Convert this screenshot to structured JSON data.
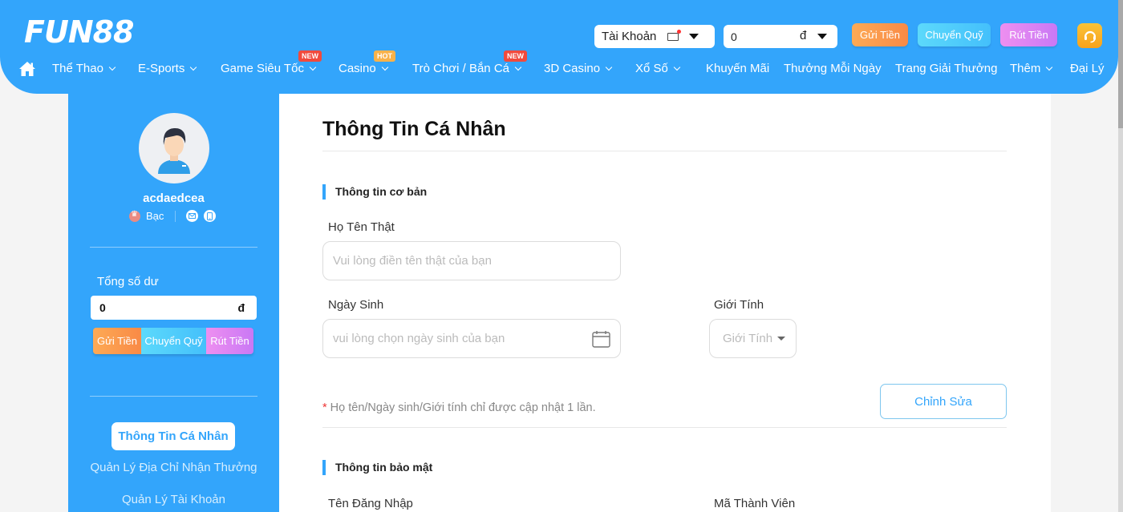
{
  "header": {
    "logo": "FUN88",
    "account": {
      "label": "Tài Khoản",
      "has_notification": true
    },
    "balance": {
      "value": "0",
      "currency": "đ"
    },
    "buttons": {
      "deposit": "Gửi Tiền",
      "transfer": "Chuyển Quỹ",
      "withdraw": "Rút Tiền"
    },
    "colors": {
      "primary": "#33a5fb",
      "deposit": "#f98a46",
      "transfer": "#44c0fb",
      "withdraw": "#c978f5",
      "support": "#f7a21b"
    }
  },
  "nav": {
    "items": [
      {
        "label": "Thể Thao",
        "dropdown": true
      },
      {
        "label": "E-Sports",
        "dropdown": true
      },
      {
        "label": "Game Siêu Tốc",
        "dropdown": true,
        "badge": "NEW"
      },
      {
        "label": "Casino",
        "dropdown": true,
        "badge": "HOT"
      },
      {
        "label": "Trò Chơi / Bắn Cá",
        "dropdown": true,
        "badge": "NEW"
      },
      {
        "label": "3D Casino",
        "dropdown": true
      },
      {
        "label": "Xổ Số",
        "dropdown": true
      },
      {
        "label": "Khuyến Mãi",
        "dropdown": false
      },
      {
        "label": "Thưởng Mỗi Ngày",
        "dropdown": false
      },
      {
        "label": "Trang Giải Thưởng",
        "dropdown": false
      },
      {
        "label": "Thêm",
        "dropdown": true
      },
      {
        "label": "Đại Lý",
        "dropdown": false
      }
    ]
  },
  "sidebar": {
    "username": "acdaedcea",
    "tier": "Bạc",
    "balance_label": "Tổng số dư",
    "balance_value": "0",
    "balance_currency": "đ",
    "buttons": {
      "deposit": "Gửi Tiền",
      "transfer": "Chuyển Quỹ",
      "withdraw": "Rút Tiền"
    },
    "menu": [
      {
        "label": "Thông Tin Cá Nhân",
        "active": true
      },
      {
        "label": "Quản Lý Địa Chỉ Nhận Thưởng",
        "active": false
      },
      {
        "label": "Quản Lý Tài Khoản",
        "active": false
      }
    ]
  },
  "main": {
    "title": "Thông Tin Cá Nhân",
    "basic_section": {
      "title": "Thông tin cơ bản",
      "full_name": {
        "label": "Họ Tên Thật",
        "placeholder": "Vui lòng điền tên thật của bạn",
        "value": ""
      },
      "birthday": {
        "label": "Ngày Sinh",
        "placeholder": "vui lòng chọn ngày sinh của bạn",
        "value": ""
      },
      "gender": {
        "label": "Giới Tính",
        "placeholder": "Giới Tính"
      },
      "note_star": "*",
      "note": "Họ tên/Ngày sinh/Giới tính chỉ được cập nhật 1 lần.",
      "edit_button": "Chỉnh Sửa"
    },
    "security_section": {
      "title": "Thông tin bảo mật",
      "username_label": "Tên Đăng Nhập",
      "member_id_label": "Mã Thành Viên"
    }
  }
}
